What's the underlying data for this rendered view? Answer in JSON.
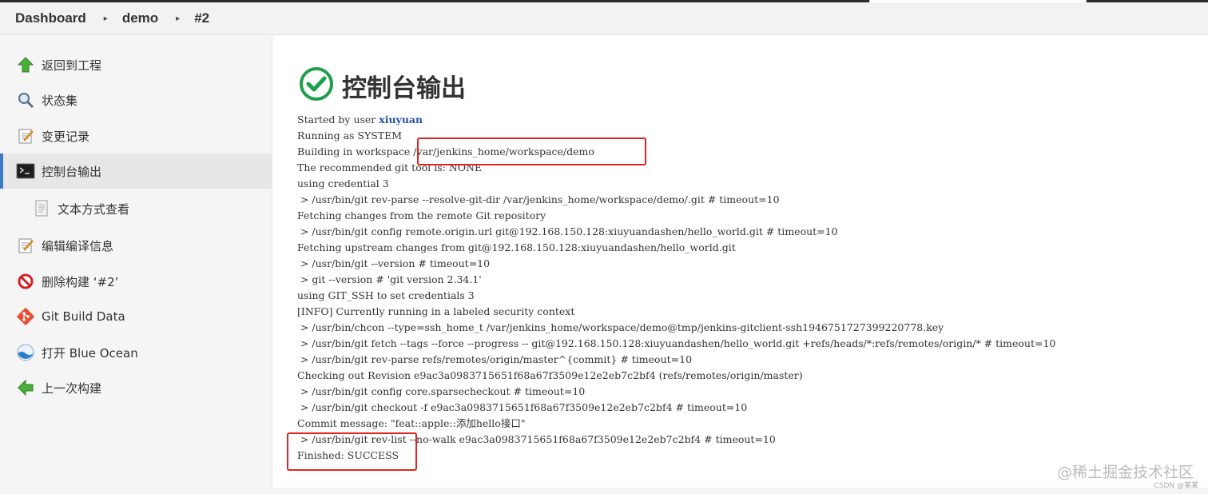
{
  "breadcrumb": {
    "items": [
      "Dashboard",
      "demo",
      "#2"
    ],
    "separator": "▸"
  },
  "sidebar": {
    "items": [
      {
        "label": "返回到工程",
        "icon": "up-arrow-icon"
      },
      {
        "label": "状态集",
        "icon": "magnifier-icon"
      },
      {
        "label": "变更记录",
        "icon": "notepad-icon"
      },
      {
        "label": "控制台输出",
        "icon": "terminal-icon",
        "active": true
      },
      {
        "label": "文本方式查看",
        "icon": "document-icon"
      },
      {
        "label": "编辑编译信息",
        "icon": "notepad-icon"
      },
      {
        "label": "删除构建 ‘#2’",
        "icon": "no-entry-icon"
      },
      {
        "label": "Git Build Data",
        "icon": "git-icon"
      },
      {
        "label": "打开 Blue Ocean",
        "icon": "blue-ocean-icon"
      },
      {
        "label": "上一次构建",
        "icon": "left-arrow-icon"
      }
    ]
  },
  "main": {
    "title": "控制台输出",
    "started_prefix": "Started by user ",
    "started_user": "xiuyuan",
    "console_lines": [
      "Running as SYSTEM",
      "Building in workspace /var/jenkins_home/workspace/demo",
      "The recommended git tool is: NONE",
      "using credential 3",
      " > /usr/bin/git rev-parse --resolve-git-dir /var/jenkins_home/workspace/demo/.git # timeout=10",
      "Fetching changes from the remote Git repository",
      " > /usr/bin/git config remote.origin.url git@192.168.150.128:xiuyuandashen/hello_world.git # timeout=10",
      "Fetching upstream changes from git@192.168.150.128:xiuyuandashen/hello_world.git",
      " > /usr/bin/git --version # timeout=10",
      " > git --version # 'git version 2.34.1'",
      "using GIT_SSH to set credentials 3",
      "[INFO] Currently running in a labeled security context",
      " > /usr/bin/chcon --type=ssh_home_t /var/jenkins_home/workspace/demo@tmp/jenkins-gitclient-ssh1946751727399220778.key",
      " > /usr/bin/git fetch --tags --force --progress -- git@192.168.150.128:xiuyuandashen/hello_world.git +refs/heads/*:refs/remotes/origin/* # timeout=10",
      " > /usr/bin/git rev-parse refs/remotes/origin/master^{commit} # timeout=10",
      "Checking out Revision e9ac3a0983715651f68a67f3509e12e2eb7c2bf4 (refs/remotes/origin/master)",
      " > /usr/bin/git config core.sparsecheckout # timeout=10",
      " > /usr/bin/git checkout -f e9ac3a0983715651f68a67f3509e12e2eb7c2bf4 # timeout=10",
      "Commit message: \"feat::apple::添加hello接口\"",
      " > /usr/bin/git rev-list --no-walk e9ac3a0983715651f68a67f3509e12e2eb7c2bf4 # timeout=10",
      "Finished: SUCCESS"
    ]
  },
  "watermark": {
    "text": "@稀土掘金技术社区",
    "csdn": "CSDN @某某"
  },
  "colors": {
    "success": "#1f9e4b",
    "highlight_box": "#e02424",
    "user_link": "#2450a8",
    "active_border": "#3a7bc8"
  }
}
